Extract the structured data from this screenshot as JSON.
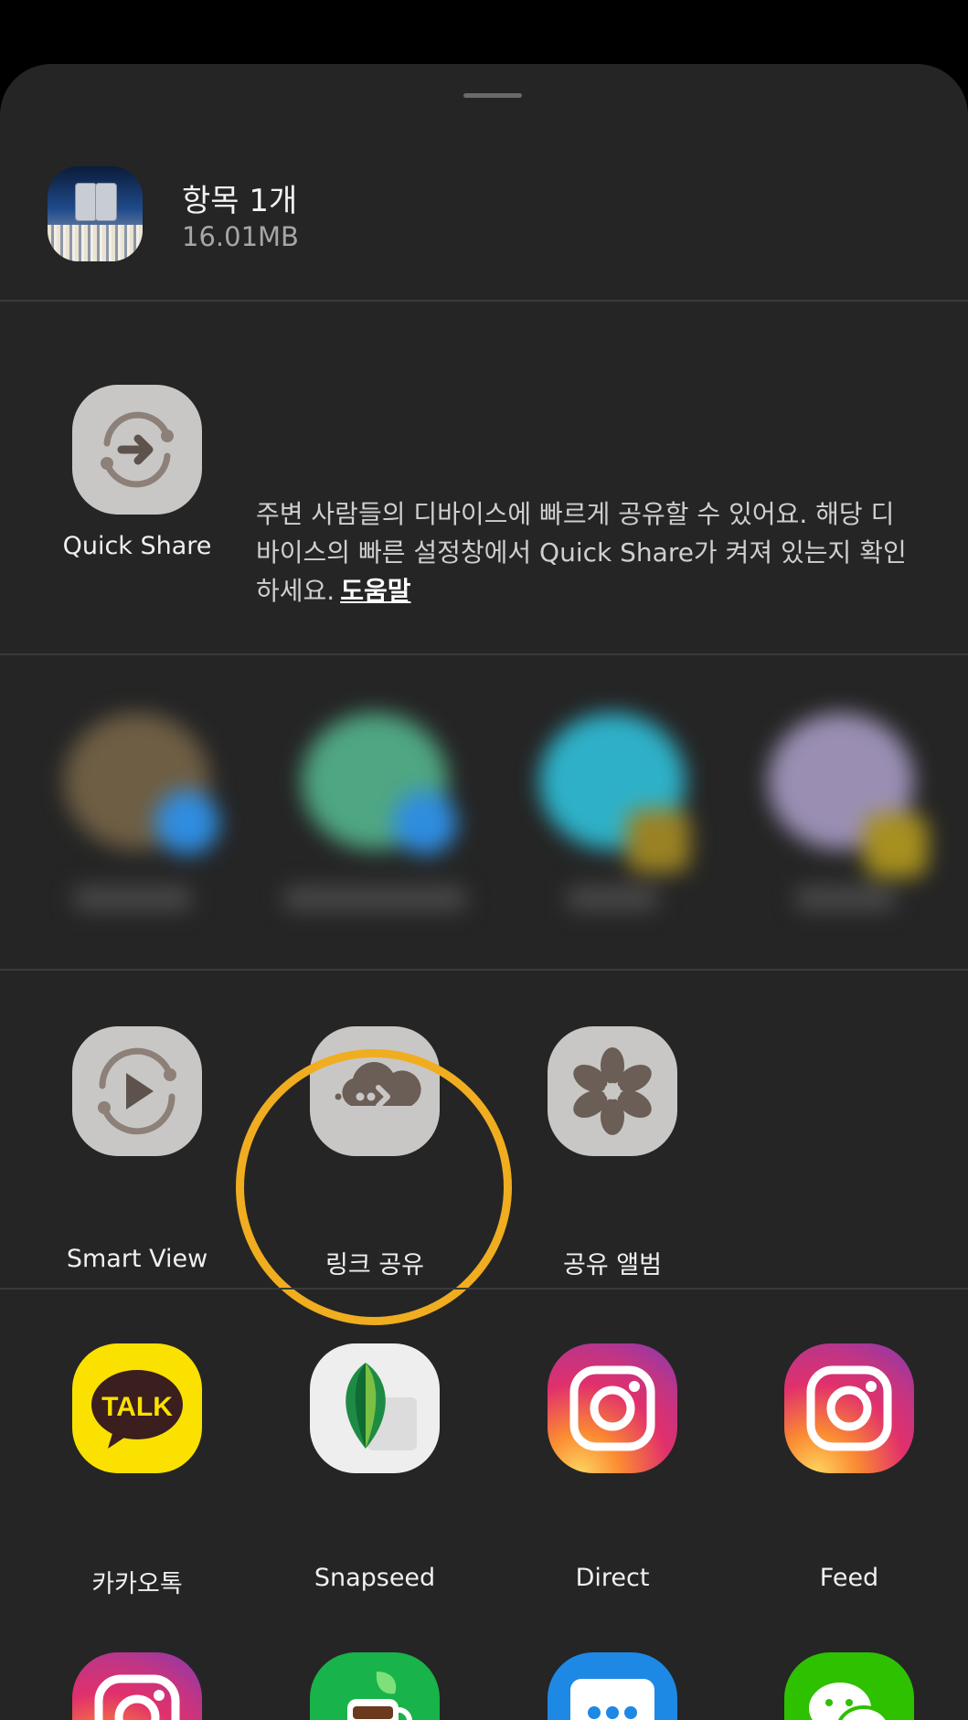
{
  "header": {
    "title": "항목 1개",
    "size": "16.01MB"
  },
  "quick_share": {
    "label": "Quick Share",
    "description": "주변 사람들의 디바이스에 빠르게 공유할 수 있어요. 해당 디바이스의 빠른 설정창에서 Quick Share가 켜져 있는지 확인하세요.",
    "help_link": "도움말"
  },
  "share_options": [
    {
      "label": "Smart View",
      "icon": "smart-view-icon"
    },
    {
      "label": "링크 공유",
      "icon": "cloud-link-icon"
    },
    {
      "label": "공유 앨범",
      "icon": "flower-album-icon"
    }
  ],
  "apps": [
    {
      "label": "카카오톡",
      "icon": "kakaotalk-icon",
      "icon_text": "TALK"
    },
    {
      "label": "Snapseed",
      "icon": "snapseed-icon"
    },
    {
      "label": "Direct",
      "icon": "instagram-icon"
    },
    {
      "label": "Feed",
      "icon": "instagram-icon"
    }
  ],
  "apps_row2": [
    {
      "icon": "instagram-icon"
    },
    {
      "icon": "coffee-app-icon"
    },
    {
      "icon": "messages-icon"
    },
    {
      "icon": "wechat-icon"
    }
  ],
  "colors": {
    "sheet_bg": "#252525",
    "highlight_ring": "#f0ad1f",
    "kakao_yellow": "#fae100",
    "icon_gray": "#c9c7c5"
  }
}
